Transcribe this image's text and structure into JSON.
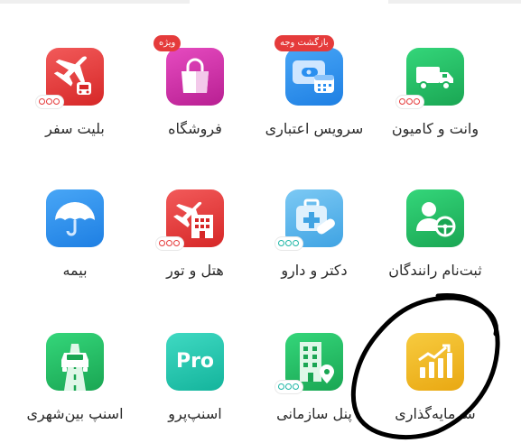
{
  "services": [
    {
      "id": "van",
      "label": "وانت و کامیون",
      "icon": "truck-icon",
      "color": "#23c165"
    },
    {
      "id": "credit",
      "label": "سرویس اعتباری",
      "badge": "بازگشت وجه",
      "icon": "wallet-icon",
      "color": "#2a8ff0"
    },
    {
      "id": "shop",
      "label": "فروشگاه",
      "badge": "ویژه",
      "icon": "shopping-bag-icon",
      "color": "#d62fa9"
    },
    {
      "id": "travel",
      "label": "بلیت سفر",
      "icon": "airplane-bus-icon",
      "color": "#e53b3b"
    },
    {
      "id": "driver",
      "label": "ثبت‌نام رانندگان",
      "icon": "driver-icon",
      "color": "#23c165"
    },
    {
      "id": "doctor",
      "label": "دکتر و دارو",
      "icon": "medical-kit-icon",
      "color": "#56b5ec"
    },
    {
      "id": "hotel",
      "label": "هتل و تور",
      "icon": "hotel-plane-icon",
      "color": "#e53b3b"
    },
    {
      "id": "insurance",
      "label": "بیمه",
      "icon": "umbrella-icon",
      "color": "#2a8ff0"
    },
    {
      "id": "invest",
      "label": "سرمایه‌گذاری",
      "icon": "chart-up-icon",
      "color": "#f0b51c"
    },
    {
      "id": "org",
      "label": "پنل سازمانی",
      "icon": "building-icon",
      "color": "#23c165"
    },
    {
      "id": "pro",
      "label": "اسنپ‌پرو",
      "icon": "pro-icon",
      "color": "#1fc9b1",
      "icon_text": "Pro"
    },
    {
      "id": "intercity",
      "label": "اسنپ بین‌شهری",
      "icon": "road-car-icon",
      "color": "#23c165"
    }
  ]
}
